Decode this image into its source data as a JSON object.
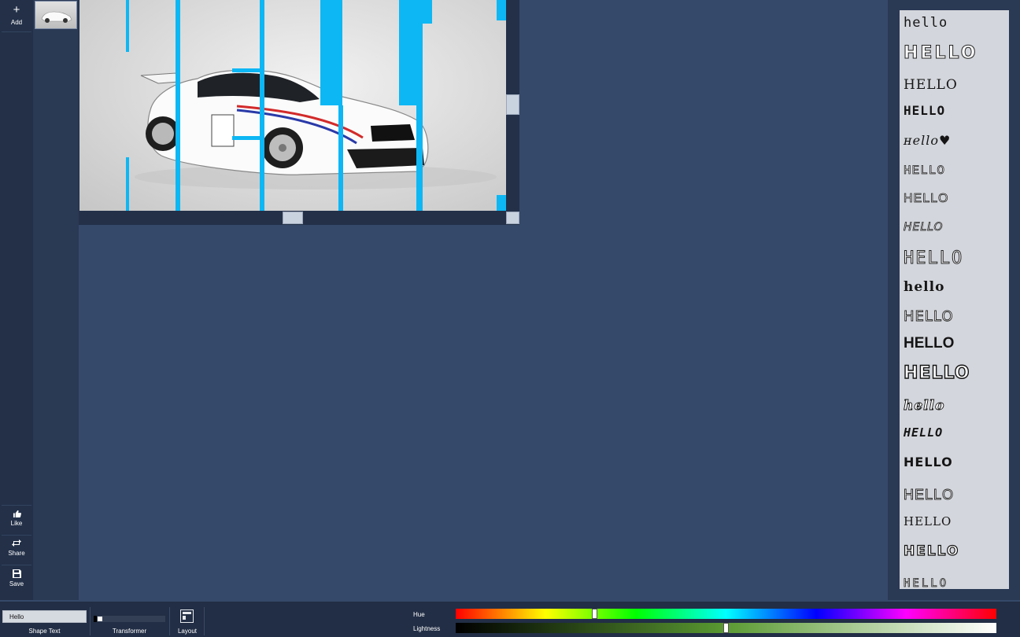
{
  "left_bar": {
    "add": {
      "icon": "plus-icon",
      "label": "Add"
    },
    "like": {
      "icon": "thumbs-up-icon",
      "label": "Like"
    },
    "share": {
      "icon": "repeat-icon",
      "label": "Share"
    },
    "save": {
      "icon": "floppy-disk-icon",
      "label": "Save"
    }
  },
  "canvas": {
    "image": "white race car with blue stripe overlay",
    "stripe_color": "#0db7f4"
  },
  "font_styles": [
    {
      "text": "hello"
    },
    {
      "text": "HELLO"
    },
    {
      "text": "HELLO"
    },
    {
      "text": "HELLO"
    },
    {
      "text": "ʜello♥"
    },
    {
      "text": "HELLO"
    },
    {
      "text": "HELLO"
    },
    {
      "text": "HELLO"
    },
    {
      "text": "HELLO"
    },
    {
      "text": "hello"
    },
    {
      "text": "HELLO"
    },
    {
      "text": "HELLO"
    },
    {
      "text": "HELLO"
    },
    {
      "text": "hello"
    },
    {
      "text": "HELLO"
    },
    {
      "text": "HELLO"
    },
    {
      "text": "HELLO"
    },
    {
      "text": "HELLO"
    },
    {
      "text": "HELLO"
    },
    {
      "text": "HELLO"
    }
  ],
  "bottom_bar": {
    "shape_text": {
      "value": "Hello",
      "label": "Shape Text"
    },
    "transformer": {
      "label": "Transformer",
      "value": 0.04
    },
    "layout": {
      "label": "Layout",
      "icon": "layout-icon"
    },
    "hue": {
      "label": "Hue",
      "value": 0.255
    },
    "lightness": {
      "label": "Lightness",
      "value": 0.5
    }
  }
}
